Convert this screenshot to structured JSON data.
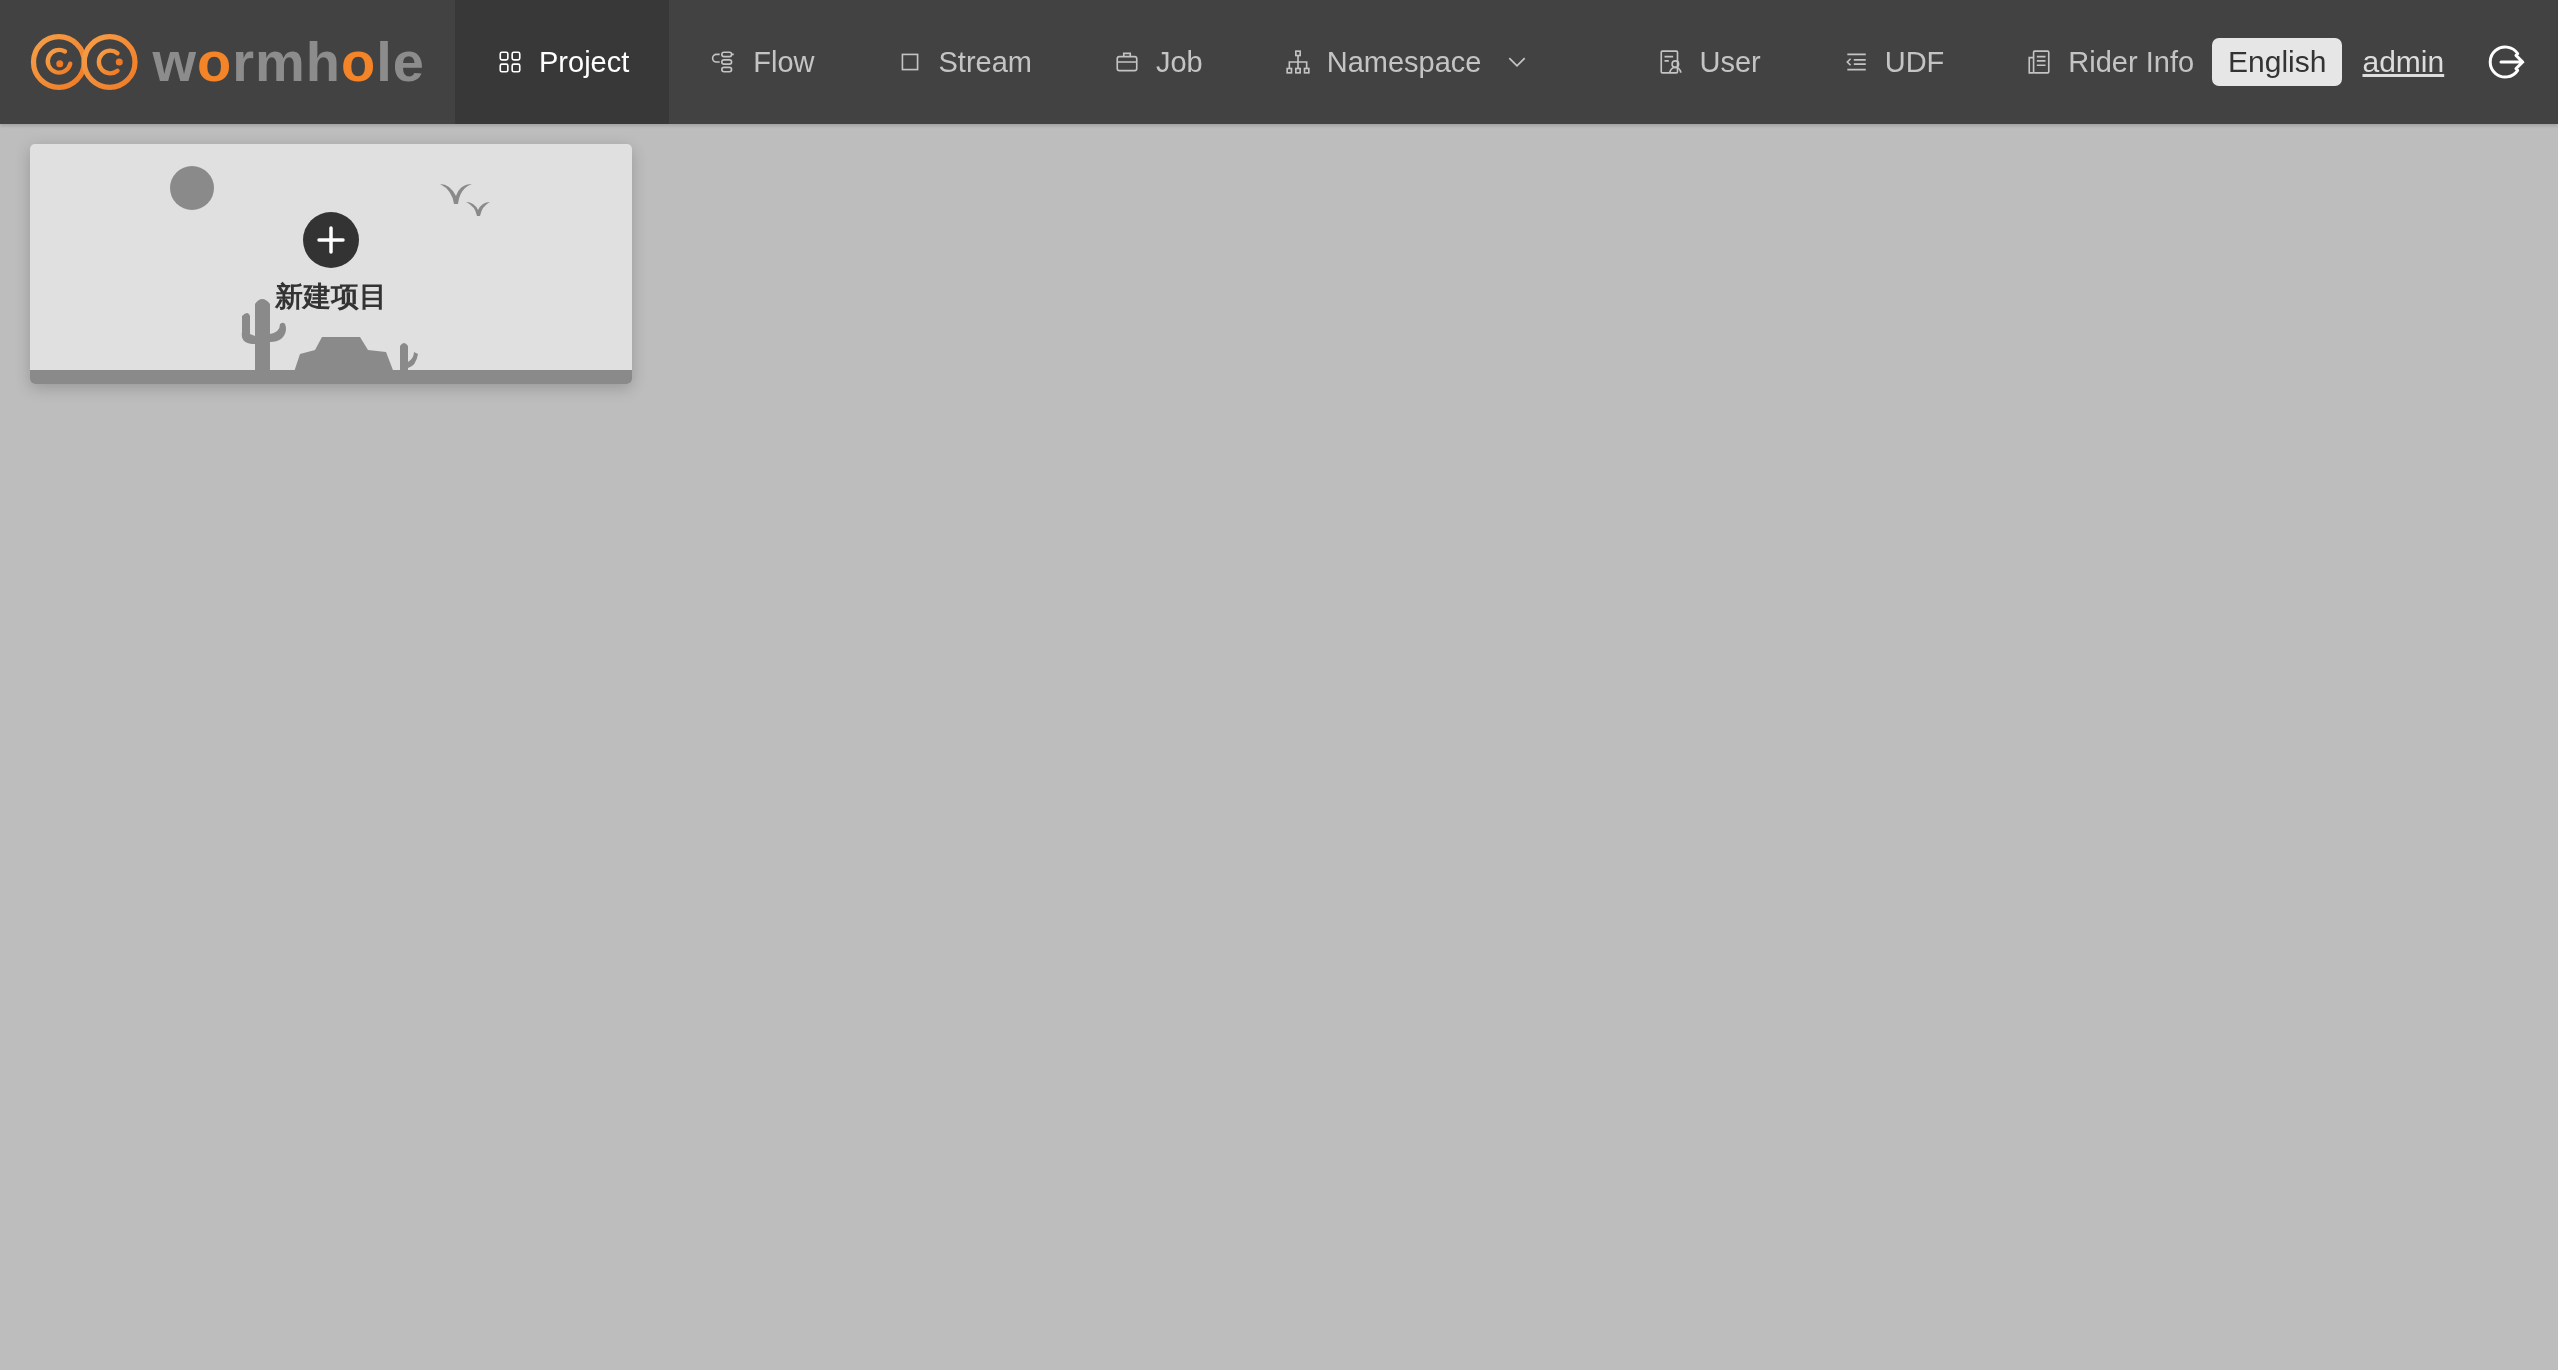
{
  "logo": {
    "parts": [
      {
        "text": "w",
        "accent": false
      },
      {
        "text": "o",
        "accent": true
      },
      {
        "text": "rmh",
        "accent": false
      },
      {
        "text": "o",
        "accent": true
      },
      {
        "text": "le",
        "accent": false
      }
    ]
  },
  "nav": [
    {
      "label": "Project",
      "selected": true,
      "dropdown": false
    },
    {
      "label": "Flow",
      "selected": false,
      "dropdown": false
    },
    {
      "label": "Stream",
      "selected": false,
      "dropdown": false
    },
    {
      "label": "Job",
      "selected": false,
      "dropdown": false
    },
    {
      "label": "Namespace",
      "selected": false,
      "dropdown": true
    },
    {
      "label": "User",
      "selected": false,
      "dropdown": false
    },
    {
      "label": "UDF",
      "selected": false,
      "dropdown": false
    },
    {
      "label": "Rider Info",
      "selected": false,
      "dropdown": false
    }
  ],
  "language_button": "English",
  "user_link": "admin",
  "new_project": {
    "label": "新建项目"
  }
}
